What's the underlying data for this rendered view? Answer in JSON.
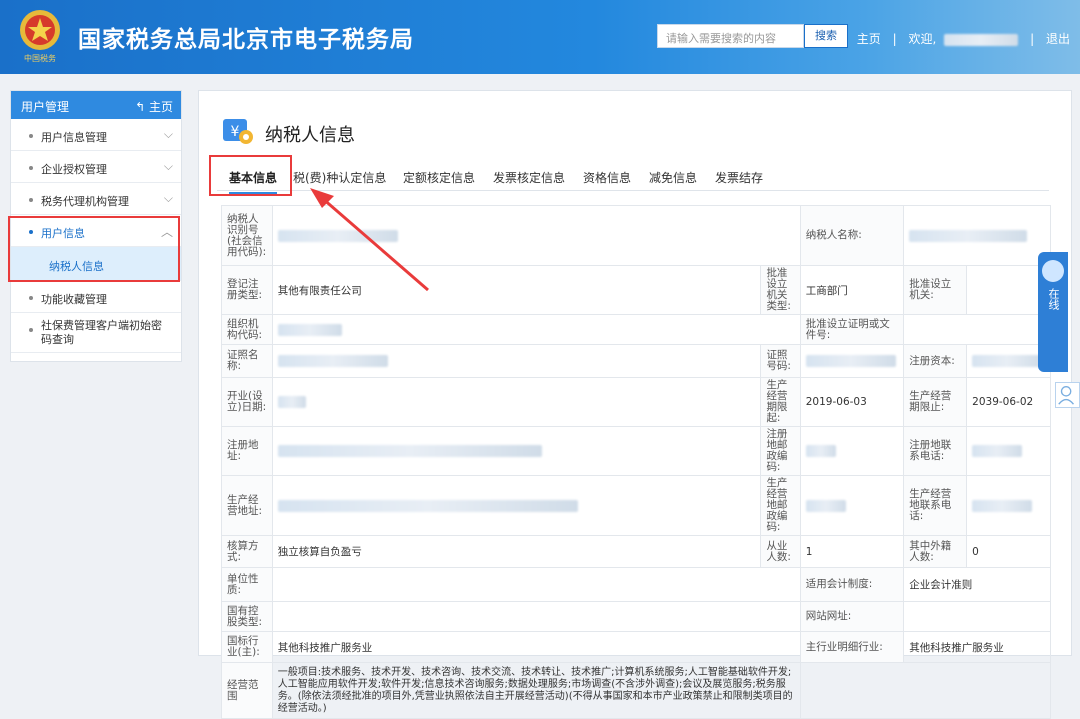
{
  "header": {
    "title": "国家税务总局北京市电子税务局",
    "search_placeholder": "请输入需要搜索的内容",
    "search_button": "搜索",
    "home_link": "主页",
    "welcome": "欢迎,",
    "logout": "退出",
    "emblem_caption": "中国税务"
  },
  "sidebar": {
    "title": "用户管理",
    "home": "主页",
    "items": [
      {
        "label": "用户信息管理"
      },
      {
        "label": "企业授权管理"
      },
      {
        "label": "税务代理机构管理"
      },
      {
        "label": "用户信息"
      },
      {
        "label": "纳税人信息"
      },
      {
        "label": "功能收藏管理"
      },
      {
        "label": "社保费管理客户端初始密码查询"
      }
    ]
  },
  "page": {
    "title": "纳税人信息",
    "tabs": [
      "基本信息",
      "税(费)种认定信息",
      "定额核定信息",
      "发票核定信息",
      "资格信息",
      "减免信息",
      "发票结存"
    ]
  },
  "table": {
    "r1": {
      "l1": "纳税人识别号(社会信用代码):",
      "l2": "纳税人名称:"
    },
    "r2": {
      "l1": "登记注册类型:",
      "v1": "其他有限责任公司",
      "l2": "批准设立机关类型:",
      "v2": "工商部门",
      "l3": "批准设立机关:"
    },
    "r3": {
      "l1": "组织机构代码:",
      "l2": "批准设立证明或文件号:"
    },
    "r4": {
      "l1": "证照名称:",
      "l2": "证照号码:",
      "l3": "注册资本:"
    },
    "r5": {
      "l1": "开业(设立)日期:",
      "l2": "生产经营期限起:",
      "v2": "2019-06-03",
      "l3": "生产经营期限止:",
      "v3": "2039-06-02"
    },
    "r6": {
      "l1": "注册地址:",
      "l2": "注册地邮政编码:",
      "l3": "注册地联系电话:"
    },
    "r7": {
      "l1": "生产经营地址:",
      "l2": "生产经营地邮政编码:",
      "l3": "生产经营地联系电话:"
    },
    "r8": {
      "l1": "核算方式:",
      "v1": "独立核算自负盈亏",
      "l2": "从业人数:",
      "v2": "1",
      "l3": "其中外籍人数:",
      "v3": "0"
    },
    "r9": {
      "l1": "单位性质:",
      "l2": "适用会计制度:",
      "v2": "企业会计准则"
    },
    "r10": {
      "l1": "国有控股类型:",
      "l2": "网站网址:"
    },
    "r11": {
      "l1": "国标行业(主):",
      "v1": "其他科技推广服务业",
      "l2": "主行业明细行业:",
      "v2": "其他科技推广服务业"
    },
    "r12": {
      "l1": "经营范围",
      "v1": "一般项目:技术服务、技术开发、技术咨询、技术交流、技术转让、技术推广;计算机系统服务;人工智能基础软件开发;人工智能应用软件开发;软件开发;信息技术咨询服务;数据处理服务;市场调查(不含涉外调查);会议及展览服务;税务服务。(除依法须经批准的项目外,凭营业执照依法自主开展经营活动)(不得从事国家和本市产业政策禁止和限制类项目的经营活动。)"
    }
  },
  "float": {
    "online": "在线"
  },
  "colors": {
    "header": "#2388de",
    "accent": "#2f8ae0",
    "highlight": "#e93b3b"
  }
}
